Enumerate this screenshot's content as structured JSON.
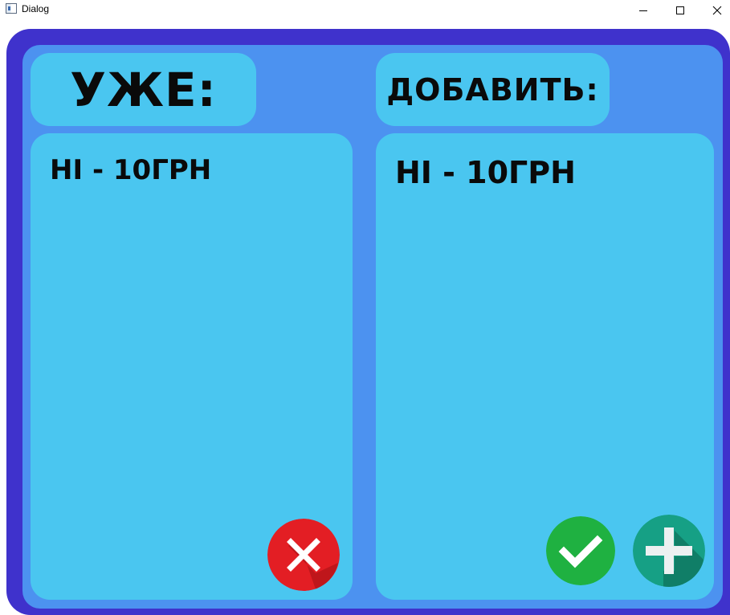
{
  "window": {
    "title": "Dialog",
    "controls": {
      "minimize_icon": "minimize-icon",
      "maximize_icon": "maximize-icon",
      "close_icon": "close-icon"
    }
  },
  "colors": {
    "outer_frame": "#3f32cc",
    "inner_frame": "#4c92f0",
    "panel": "#4ac6f0",
    "remove_button": "#e31e24",
    "confirm_button": "#1fb141",
    "add_button": "#16a085"
  },
  "existing": {
    "header": "уже:",
    "items": [
      "hi - 10грн"
    ],
    "remove_button_icon": "cross-icon"
  },
  "add": {
    "header": "добавить:",
    "items": [
      "hi - 10грн"
    ],
    "confirm_button_icon": "checkmark-icon",
    "add_button_icon": "plus-icon"
  }
}
